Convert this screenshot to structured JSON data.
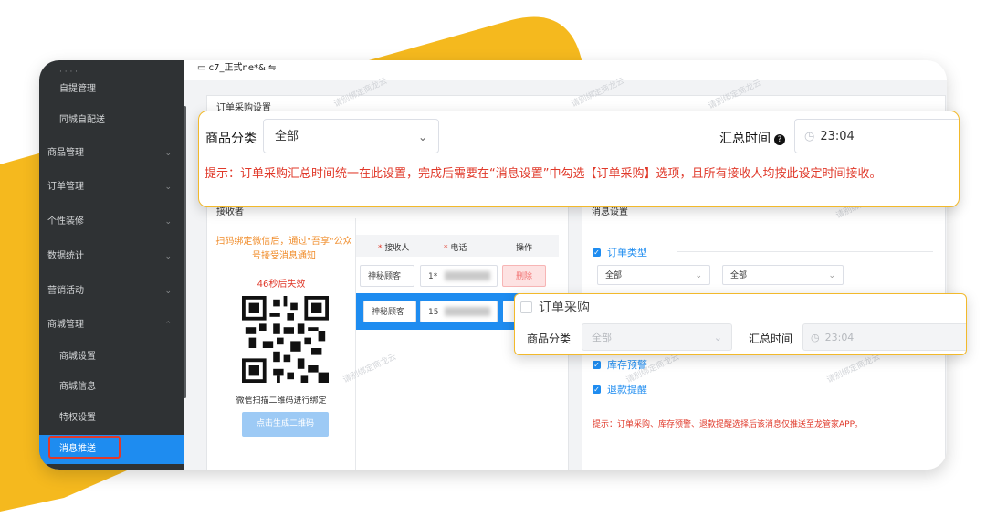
{
  "window": {
    "store_name": "c7_正式ne*&",
    "switch_icon": "swap-icon"
  },
  "sidebar": {
    "items": [
      {
        "label": "自提管理",
        "level": "sub"
      },
      {
        "label": "同城自配送",
        "level": "sub"
      },
      {
        "label": "商品管理",
        "level": "top"
      },
      {
        "label": "订单管理",
        "level": "top"
      },
      {
        "label": "个性装修",
        "level": "top"
      },
      {
        "label": "数据统计",
        "level": "top"
      },
      {
        "label": "营销活动",
        "level": "top"
      },
      {
        "label": "商城管理",
        "level": "top"
      },
      {
        "label": "商城设置",
        "level": "sub"
      },
      {
        "label": "商城信息",
        "level": "sub"
      },
      {
        "label": "特权设置",
        "level": "sub"
      },
      {
        "label": "消息推送",
        "level": "sub",
        "active": true
      }
    ]
  },
  "order_section": {
    "title": "订单采购设置"
  },
  "receiver_panel": {
    "title": "接收者",
    "qr_tip": "扫码绑定微信后，通过\"吾享\"公众号接受消息通知",
    "expire": "46秒后失效",
    "scan_caption": "微信扫描二维码进行绑定",
    "generate_button": "点击生成二维码",
    "columns": [
      "接收人",
      "电话",
      "操作"
    ],
    "rows": [
      {
        "name": "神秘顾客",
        "phone": "1*",
        "action": "删除"
      },
      {
        "name": "神秘顾客",
        "phone": "15",
        "action": ""
      }
    ]
  },
  "message_panel": {
    "title": "消息设置",
    "order_type_label": "订单类型",
    "select_a": "全部",
    "select_b": "全部",
    "stock_warning": "库存预警",
    "refund_reminder": "退款提醒",
    "tip": "提示：订单采购、库存预警、退款提醒选择后该消息仅推送至龙管家APP。"
  },
  "callout_main": {
    "category_label": "商品分类",
    "category_value": "全部",
    "summary_time_label": "汇总时间",
    "summary_time_value": "23:04",
    "tip": "提示：订单采购汇总时间统一在此设置，完成后需要在“消息设置”中勾选【订单采购】选项，且所有接收人均按此设定时间接收。"
  },
  "callout_purchase": {
    "title": "订单采购",
    "category_label": "商品分类",
    "category_value": "全部",
    "summary_time_label": "汇总时间",
    "summary_time_value": "23:04"
  },
  "watermark": "请别绑定商龙云",
  "colors": {
    "accent_yellow": "#F5B91E",
    "sidebar_bg": "#2F3234",
    "active_blue": "#1E8CF0",
    "tip_red": "#E0392A",
    "qr_tip_orange": "#F08C2A"
  }
}
